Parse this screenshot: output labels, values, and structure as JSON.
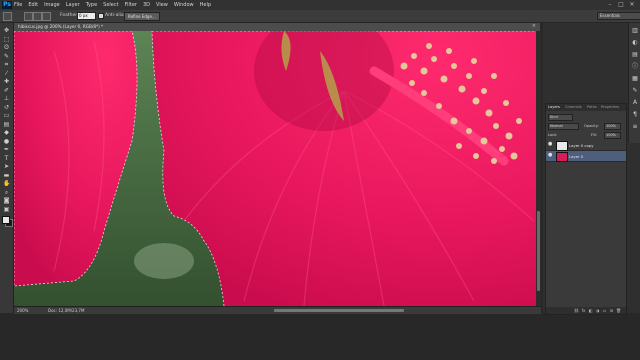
{
  "app": {
    "logo": "Ps",
    "menu": [
      "File",
      "Edit",
      "Image",
      "Layer",
      "Type",
      "Select",
      "Filter",
      "3D",
      "View",
      "Window",
      "Help"
    ],
    "window_controls": [
      "–",
      "□",
      "✕"
    ]
  },
  "options_bar": {
    "feather_label": "Feather:",
    "feather_value": "0 px",
    "anti_alias_label": "Anti-alias",
    "refine_edge_label": "Refine Edge...",
    "workspace_label": "Essentials"
  },
  "document": {
    "tab_title": "hibiscus.jpg @ 200% (Layer 0, RGB/8*) *",
    "zoom": "200%",
    "doc_size": "Doc: 12,0M/23,7M",
    "colors": {
      "petal": "#e8175d",
      "petal_dark": "#b8083f",
      "foliage": "#4a6e45",
      "stamen": "#e6c79a"
    }
  },
  "tools": [
    {
      "icon": "move-icon",
      "glyph": "✥"
    },
    {
      "icon": "marquee-icon",
      "glyph": "⬚"
    },
    {
      "icon": "lasso-icon",
      "glyph": "ʘ"
    },
    {
      "icon": "quick-select-icon",
      "glyph": "✎"
    },
    {
      "icon": "crop-icon",
      "glyph": "⌗"
    },
    {
      "icon": "eyedropper-icon",
      "glyph": "⁄"
    },
    {
      "icon": "healing-icon",
      "glyph": "✚"
    },
    {
      "icon": "brush-icon",
      "glyph": "✐"
    },
    {
      "icon": "clone-stamp-icon",
      "glyph": "⊥"
    },
    {
      "icon": "history-brush-icon",
      "glyph": "↺"
    },
    {
      "icon": "eraser-icon",
      "glyph": "▭"
    },
    {
      "icon": "gradient-icon",
      "glyph": "▤"
    },
    {
      "icon": "blur-icon",
      "glyph": "◆"
    },
    {
      "icon": "dodge-icon",
      "glyph": "●"
    },
    {
      "icon": "pen-icon",
      "glyph": "✒"
    },
    {
      "icon": "type-icon",
      "glyph": "T"
    },
    {
      "icon": "path-select-icon",
      "glyph": "➤"
    },
    {
      "icon": "shape-icon",
      "glyph": "▬"
    },
    {
      "icon": "hand-icon",
      "glyph": "✋"
    },
    {
      "icon": "zoom-icon",
      "glyph": "⌕"
    },
    {
      "icon": "quick-mask-icon",
      "glyph": "◙"
    },
    {
      "icon": "screen-mode-icon",
      "glyph": "▣"
    }
  ],
  "side_icons": [
    "▥",
    "◐",
    "▤",
    "ⓘ",
    "▦",
    "✎",
    "A",
    "¶",
    "≡"
  ],
  "layers_panel": {
    "tabs": [
      "Layers",
      "Channels",
      "Paths",
      "Properties"
    ],
    "kind_label": "Kind",
    "blend_mode": "Normal",
    "opacity_label": "Opacity:",
    "opacity_value": "100%",
    "lock_label": "Lock:",
    "fill_label": "Fill:",
    "fill_value": "100%",
    "layers": [
      {
        "name": "Layer 0 copy",
        "selected": false
      },
      {
        "name": "Layer 0",
        "selected": true
      }
    ],
    "footer_icons": [
      "⛓",
      "fx",
      "◧",
      "◑",
      "▭",
      "⊞",
      "🗑"
    ]
  }
}
